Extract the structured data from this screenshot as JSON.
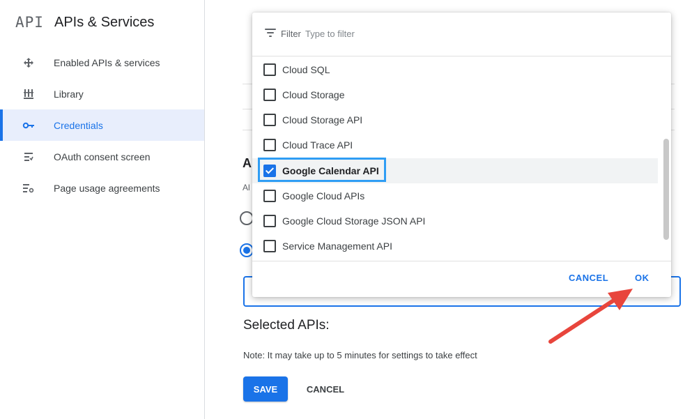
{
  "sidebar": {
    "logo": "API",
    "title": "APIs & Services",
    "items": [
      {
        "label": "Enabled APIs & services",
        "icon": "enabled-apis-icon",
        "active": false
      },
      {
        "label": "Library",
        "icon": "library-icon",
        "active": false
      },
      {
        "label": "Credentials",
        "icon": "key-icon",
        "active": true
      },
      {
        "label": "OAuth consent screen",
        "icon": "oauth-consent-icon",
        "active": false
      },
      {
        "label": "Page usage agreements",
        "icon": "page-usage-settings-icon",
        "active": false
      }
    ]
  },
  "main": {
    "partial_heading": "A",
    "partial_text": "Al",
    "selected_apis_heading": "Selected APIs:",
    "note": "Note: It may take up to 5 minutes for settings to take effect",
    "save_label": "SAVE",
    "cancel_label": "CANCEL"
  },
  "dropdown": {
    "filter_label": "Filter",
    "filter_placeholder": "Type to filter",
    "filter_icon": "filter-list-icon",
    "options": [
      {
        "label": "Cloud SQL",
        "checked": false
      },
      {
        "label": "Cloud Storage",
        "checked": false
      },
      {
        "label": "Cloud Storage API",
        "checked": false
      },
      {
        "label": "Cloud Trace API",
        "checked": false
      },
      {
        "label": "Google Calendar API",
        "checked": true
      },
      {
        "label": "Google Cloud APIs",
        "checked": false
      },
      {
        "label": "Google Cloud Storage JSON API",
        "checked": false
      },
      {
        "label": "Service Management API",
        "checked": false
      }
    ],
    "cancel_label": "CANCEL",
    "ok_label": "OK"
  },
  "colors": {
    "accent": "#1a73e8",
    "highlight_box": "#2f9df4",
    "annotation_arrow": "#e8453c",
    "active_nav_bg": "#e8eefc"
  }
}
